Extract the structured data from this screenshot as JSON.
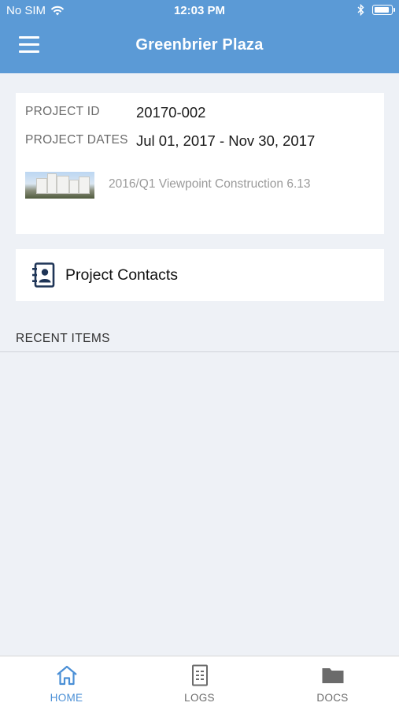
{
  "status_bar": {
    "carrier": "No SIM",
    "time": "12:03 PM"
  },
  "header": {
    "title": "Greenbrier Plaza"
  },
  "project": {
    "id_label": "PROJECT ID",
    "id_value": "20170-002",
    "dates_label": "PROJECT DATES",
    "dates_value": "Jul 01, 2017 - Nov 30, 2017",
    "version": "2016/Q1 Viewpoint Construction 6.13"
  },
  "contacts": {
    "label": "Project Contacts"
  },
  "recent": {
    "label": "RECENT ITEMS"
  },
  "tabs": [
    {
      "label": "HOME",
      "icon": "home-icon",
      "active": true
    },
    {
      "label": "LOGS",
      "icon": "logs-icon",
      "active": false
    },
    {
      "label": "DOCS",
      "icon": "folder-icon",
      "active": false
    }
  ],
  "colors": {
    "accent": "#5b9ad6",
    "tab_active": "#4a8fd6",
    "background": "#eef1f6"
  }
}
